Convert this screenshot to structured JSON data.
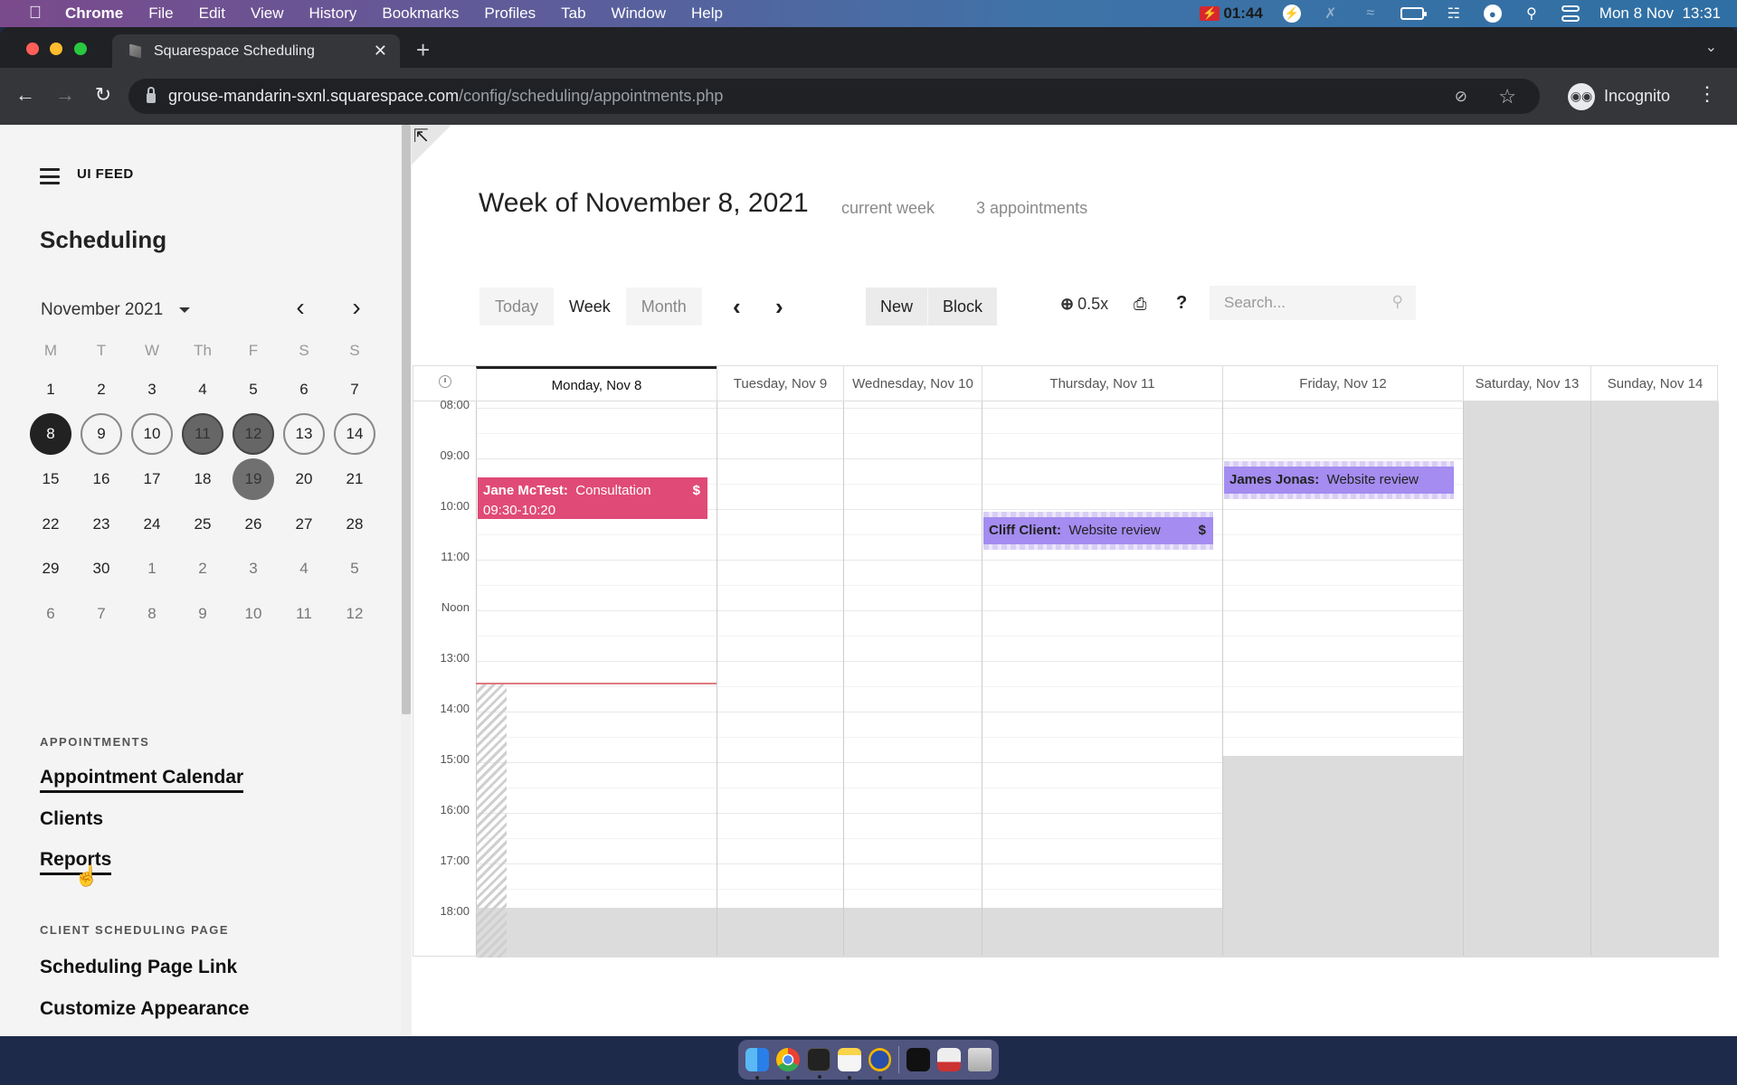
{
  "menubar": {
    "app_name": "Chrome",
    "items": [
      "File",
      "Edit",
      "View",
      "History",
      "Bookmarks",
      "Profiles",
      "Tab",
      "Window",
      "Help"
    ],
    "recording_time": "01:44",
    "datetime": "Mon 8 Nov  13:31"
  },
  "browser": {
    "tab_title": "Squarespace Scheduling",
    "url_host": "grouse-mandarin-sxnl.squarespace.com",
    "url_path": "/config/scheduling/appointments.php",
    "profile_label": "Incognito"
  },
  "sidebar": {
    "brand": "UI FEED",
    "title": "Scheduling",
    "month_label": "November 2021",
    "weekday_headers": [
      "M",
      "T",
      "W",
      "Th",
      "F",
      "S",
      "S"
    ],
    "weeks": [
      [
        {
          "d": "1"
        },
        {
          "d": "2"
        },
        {
          "d": "3"
        },
        {
          "d": "4"
        },
        {
          "d": "5"
        },
        {
          "d": "6"
        },
        {
          "d": "7"
        }
      ],
      [
        {
          "d": "8",
          "s": "today"
        },
        {
          "d": "9",
          "s": "week"
        },
        {
          "d": "10",
          "s": "week"
        },
        {
          "d": "11",
          "s": "busy"
        },
        {
          "d": "12",
          "s": "busy"
        },
        {
          "d": "13",
          "s": "week"
        },
        {
          "d": "14",
          "s": "week"
        }
      ],
      [
        {
          "d": "15"
        },
        {
          "d": "16"
        },
        {
          "d": "17"
        },
        {
          "d": "18"
        },
        {
          "d": "19",
          "s": "busy-plain"
        },
        {
          "d": "20"
        },
        {
          "d": "21"
        }
      ],
      [
        {
          "d": "22"
        },
        {
          "d": "23"
        },
        {
          "d": "24"
        },
        {
          "d": "25"
        },
        {
          "d": "26"
        },
        {
          "d": "27"
        },
        {
          "d": "28"
        }
      ],
      [
        {
          "d": "29"
        },
        {
          "d": "30"
        },
        {
          "d": "1",
          "m": true
        },
        {
          "d": "2",
          "m": true
        },
        {
          "d": "3",
          "m": true
        },
        {
          "d": "4",
          "m": true
        },
        {
          "d": "5",
          "m": true
        }
      ],
      [
        {
          "d": "6",
          "m": true
        },
        {
          "d": "7",
          "m": true
        },
        {
          "d": "8",
          "m": true
        },
        {
          "d": "9",
          "m": true
        },
        {
          "d": "10",
          "m": true
        },
        {
          "d": "11",
          "m": true
        },
        {
          "d": "12",
          "m": true
        }
      ]
    ],
    "appointments_section": "APPOINTMENTS",
    "appointments_links": [
      "Appointment Calendar",
      "Clients",
      "Reports"
    ],
    "client_section": "CLIENT SCHEDULING PAGE",
    "client_links": [
      "Scheduling Page Link",
      "Customize Appearance"
    ]
  },
  "main": {
    "week_title": "Week of November 8, 2021",
    "current_week_label": "current week",
    "appointment_count": "3 appointments",
    "view_buttons": [
      "Today",
      "Week",
      "Month"
    ],
    "active_view": "Week",
    "action_buttons": [
      "New",
      "Block"
    ],
    "zoom_level": "0.5x",
    "search_placeholder": "Search...",
    "days": [
      "Monday, Nov 8",
      "Tuesday, Nov 9",
      "Wednesday, Nov 10",
      "Thursday, Nov 11",
      "Friday, Nov 12",
      "Saturday, Nov 13",
      "Sunday, Nov 14"
    ],
    "times": [
      "08:00",
      "09:00",
      "10:00",
      "11:00",
      "Noon",
      "13:00",
      "14:00",
      "15:00",
      "16:00",
      "17:00",
      "18:00"
    ],
    "current_time": "13:31",
    "appointments": [
      {
        "client": "Jane McTest:",
        "type": "Consultation",
        "time": "09:30-10:20",
        "day": "Monday, Nov 8",
        "paid_marker": "$",
        "color": "#e04a76"
      },
      {
        "client": "Cliff Client:",
        "type": "Website review",
        "day": "Thursday, Nov 11",
        "paid_marker": "$",
        "color": "#a48cf0"
      },
      {
        "client": "James Jonas:",
        "type": "Website review",
        "day": "Friday, Nov 12",
        "color": "#a48cf0"
      }
    ]
  }
}
